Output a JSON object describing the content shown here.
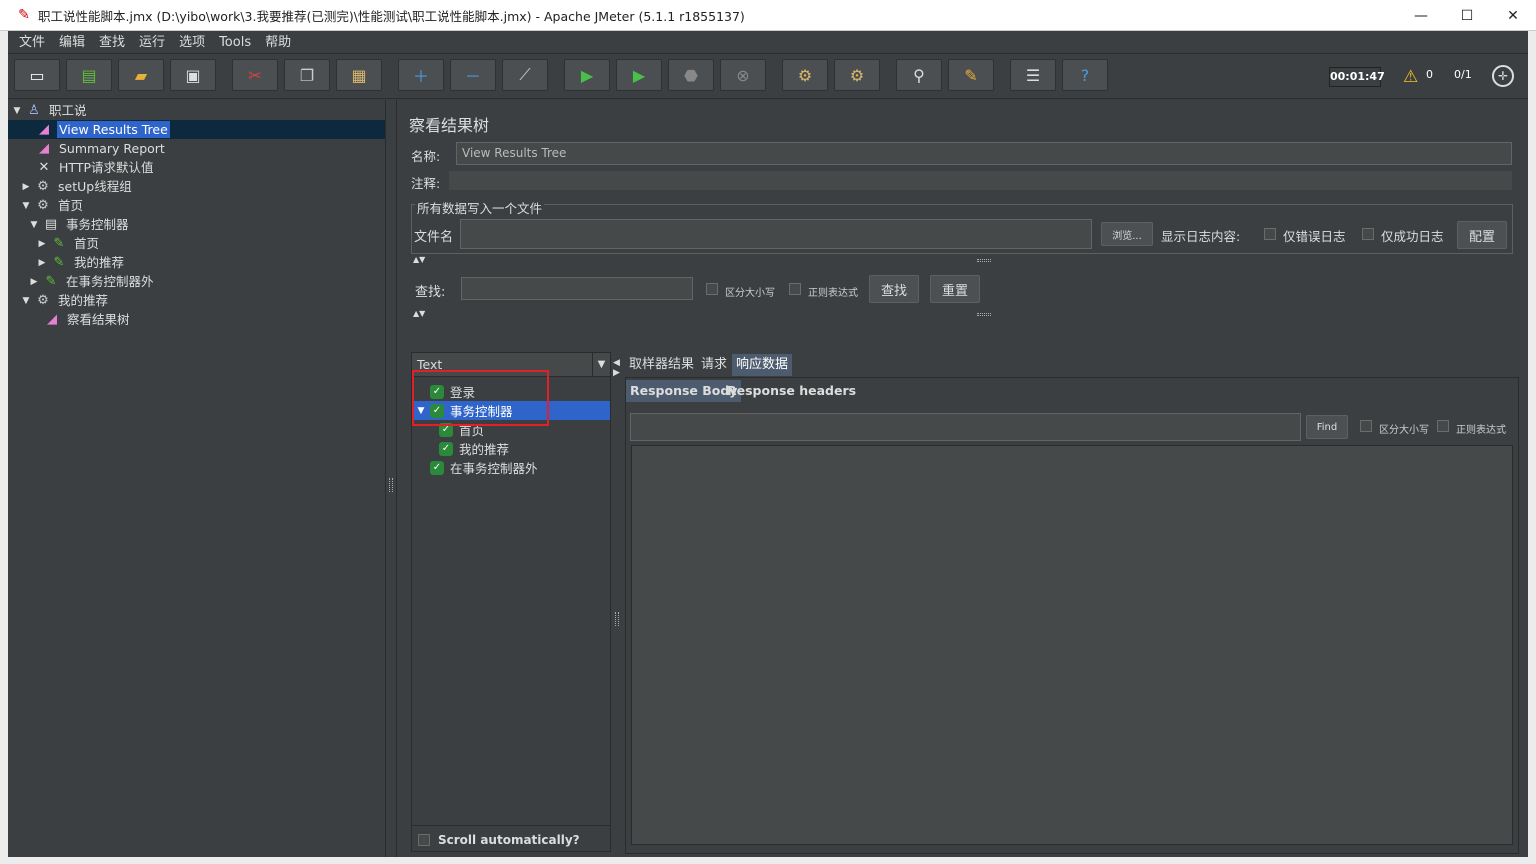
{
  "window": {
    "title": "职工说性能脚本.jmx (D:\\yibo\\work\\3.我要推荐(已测完)\\性能测试\\职工说性能脚本.jmx) - Apache JMeter (5.1.1 r1855137)",
    "minimize": "—",
    "maximize": "☐",
    "close": "✕"
  },
  "menu": [
    "文件",
    "编辑",
    "查找",
    "运行",
    "选项",
    "Tools",
    "帮助"
  ],
  "toolbar": {
    "buttons": [
      "new-icon",
      "templates-icon",
      "open-icon",
      "save-icon",
      "cut-icon",
      "copy-icon",
      "paste-icon",
      "expand-icon",
      "collapse-icon",
      "toggle-icon",
      "start-icon",
      "start-no-pause-icon",
      "stop-icon",
      "shutdown-icon",
      "clear-icon",
      "clear-all-icon",
      "search-icon",
      "reset-search-icon",
      "function-helper-icon",
      "help-icon"
    ],
    "timer": "00:01:47",
    "warnings": "0",
    "threads": "0/1"
  },
  "tree": [
    {
      "label": "职工说",
      "icon": "flask-icon"
    },
    {
      "label": "View Results Tree",
      "icon": "chart-icon"
    },
    {
      "label": "Summary Report",
      "icon": "chart-icon"
    },
    {
      "label": "HTTP请求默认值",
      "icon": "tools-icon"
    },
    {
      "label": "setUp线程组",
      "icon": "gear-icon"
    },
    {
      "label": "首页",
      "icon": "gear-icon"
    },
    {
      "label": "事务控制器",
      "icon": "controller-icon"
    },
    {
      "label": "首页",
      "icon": "pen-icon"
    },
    {
      "label": "我的推荐",
      "icon": "pen-icon"
    },
    {
      "label": "在事务控制器外",
      "icon": "pen-icon"
    },
    {
      "label": "我的推荐",
      "icon": "gear-icon"
    },
    {
      "label": "察看结果树",
      "icon": "chart-icon"
    }
  ],
  "panel": {
    "title": "察看结果树",
    "name_label": "名称:",
    "name_value": "View Results Tree",
    "comment_label": "注释:",
    "group_title": "所有数据写入一个文件",
    "filename_label": "文件名",
    "browse": "浏览...",
    "log_label": "显示日志内容:",
    "errors_only": "仅错误日志",
    "success_only": "仅成功日志",
    "configure": "配置",
    "search_label": "查找:",
    "case_sensitive": "区分大小写",
    "regex": "正则表达式",
    "search_btn": "查找",
    "reset_btn": "重置"
  },
  "results": {
    "renderer": "Text",
    "items": [
      {
        "label": "登录"
      },
      {
        "label": "事务控制器"
      },
      {
        "label": "首页"
      },
      {
        "label": "我的推荐"
      },
      {
        "label": "在事务控制器外"
      }
    ],
    "scroll_auto": "Scroll automatically?"
  },
  "tabs": [
    "取样器结果",
    "请求",
    "响应数据"
  ],
  "subtabs": [
    "Response Body",
    "Response headers"
  ],
  "find": {
    "button": "Find",
    "case_sensitive": "区分大小写",
    "regex": "正则表达式"
  }
}
